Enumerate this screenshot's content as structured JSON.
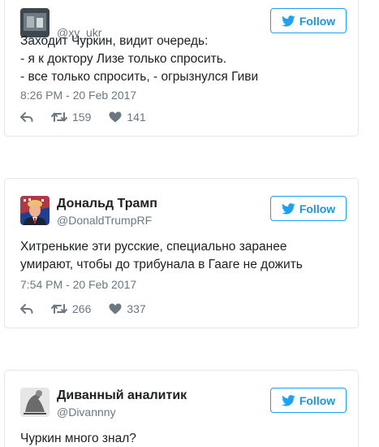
{
  "tweets": [
    {
      "name": "",
      "handle": "@xy_ukr",
      "follow_label": "Follow",
      "text_lines": [
        "Заходит Чуркин, видит очередь:",
        "- я к доктору Лизе только спросить.",
        "- все только спросить, - огрызнулся Гиви"
      ],
      "time": "8:26 PM - 20 Feb 2017",
      "retweets": "159",
      "likes": "141"
    },
    {
      "name": "Дональд Трамп",
      "handle": "@DonaldTrumpRF",
      "follow_label": "Follow",
      "text_lines": [
        "Хитренькие эти русские, специально заранее",
        "умирают, чтобы до трибунала в Гааге не дожить"
      ],
      "time": "7:54 PM - 20 Feb 2017",
      "retweets": "266",
      "likes": "337"
    },
    {
      "name": "Диванный аналитик",
      "handle": "@Divannny",
      "follow_label": "Follow",
      "text_lines": [
        "Чуркин много знал?"
      ]
    }
  ],
  "icons": [
    "reply-icon",
    "retweet-icon",
    "heart-icon",
    "twitter-bird-icon"
  ],
  "colors": {
    "accent": "#1da1f2",
    "follow_text": "#1b95e0",
    "meta": "#697882",
    "border": "#e1e8ed"
  }
}
